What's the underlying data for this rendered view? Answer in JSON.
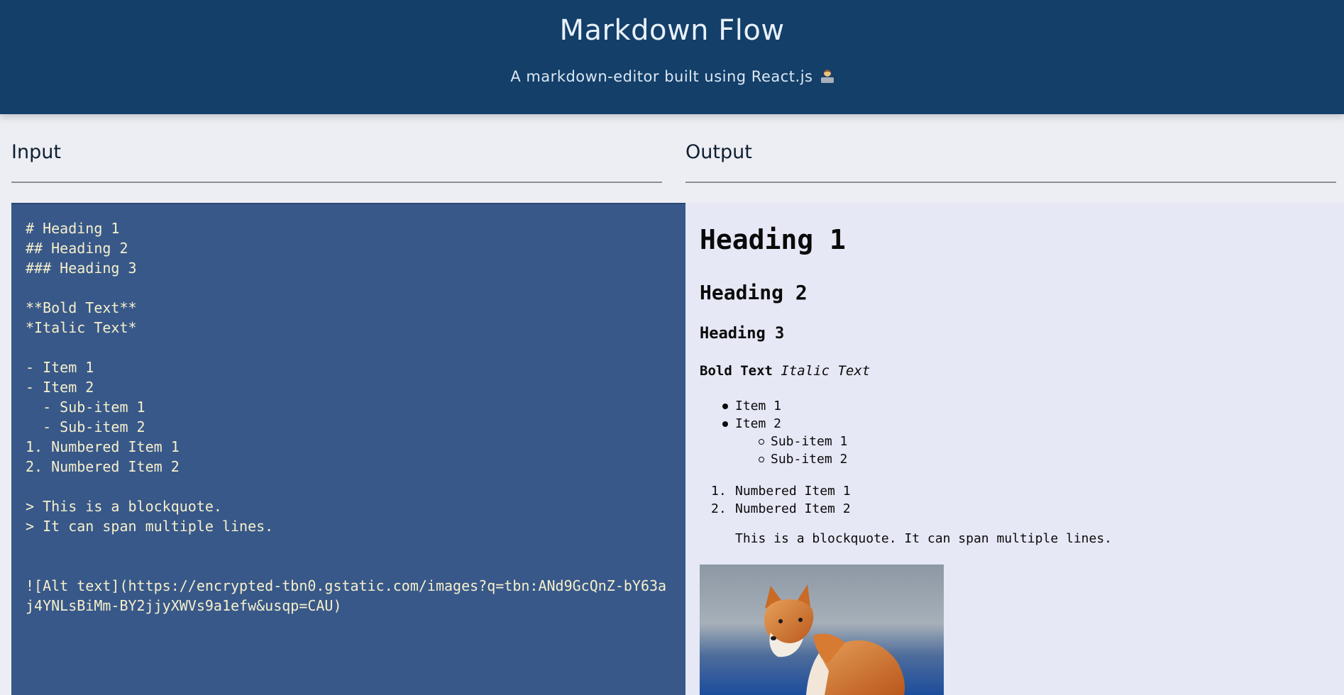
{
  "header": {
    "title": "Markdown Flow",
    "subtitle": "A markdown-editor built using React.js",
    "subtitle_icon": "technologist-emoji"
  },
  "input_panel": {
    "title": "Input",
    "editor_value": "# Heading 1\n## Heading 2\n### Heading 3\n\n**Bold Text**\n*Italic Text*\n\n- Item 1\n- Item 2\n  - Sub-item 1\n  - Sub-item 2\n1. Numbered Item 1\n2. Numbered Item 2\n\n> This is a blockquote.\n> It can span multiple lines.\n\n\n![Alt text](https://encrypted-tbn0.gstatic.com/images?q=tbn:ANd9GcQnZ-bY63aj4YNLsBiMm-BY2jjyXWVs9a1efw&usqp=CAU)"
  },
  "output_panel": {
    "title": "Output",
    "h1": "Heading 1",
    "h2": "Heading 2",
    "h3": "Heading 3",
    "bold": "Bold Text",
    "italic": "Italic Text",
    "list_items": [
      "Item 1",
      "Item 2"
    ],
    "sub_items": [
      "Sub-item 1",
      "Sub-item 2"
    ],
    "numbered_items": [
      "Numbered Item 1",
      "Numbered Item 2"
    ],
    "numbers": [
      "1.",
      "2."
    ],
    "blockquote": "This is a blockquote. It can span multiple lines.",
    "image_alt": "Alt text"
  },
  "colors": {
    "header_bg": "#133f69",
    "editor_bg": "#385889",
    "editor_text": "#f6f0cc",
    "output_bg": "#e6e8f5",
    "page_bg": "#eceef3"
  }
}
